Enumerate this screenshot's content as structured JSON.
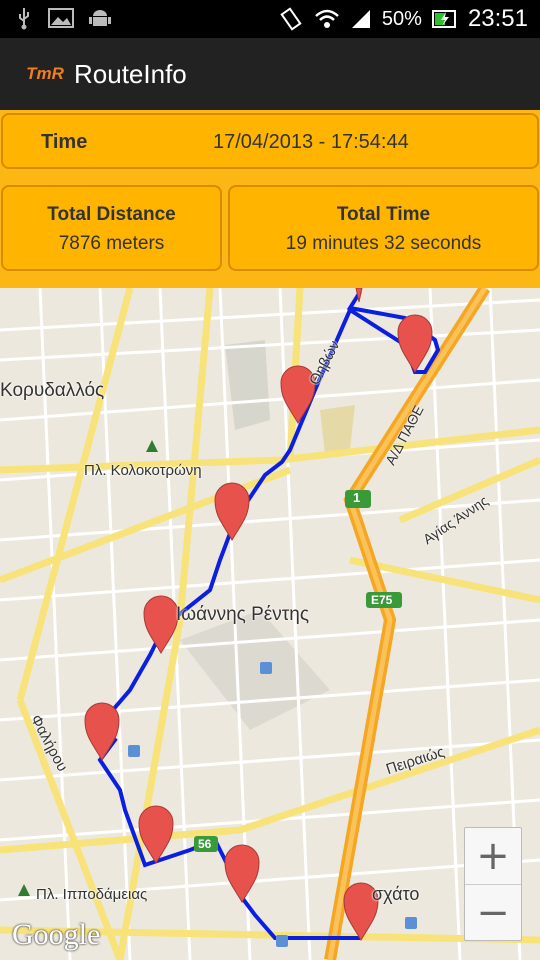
{
  "status_bar": {
    "battery": "50%",
    "time": "23:51"
  },
  "app": {
    "logo_text": "TmR",
    "title": "RouteInfo"
  },
  "info": {
    "time_label": "Time",
    "time_value": "17/04/2013 - 17:54:44",
    "distance_label": "Total Distance",
    "distance_value": "7876 meters",
    "total_time_label": "Total Time",
    "total_time_value": "19 minutes 32 seconds"
  },
  "map": {
    "labels": {
      "korydallos": "Κορυδαλλός",
      "kolokotroni": "Πλ. Κολοκοτρώνη",
      "rentis": "Ιωάννης Ρέντης",
      "faliro": "Φαλήρου",
      "ippodameias": "Πλ. Ιπποδάμειας",
      "thivon": "Θηβών",
      "athens_highway": "Α/Δ ΠΑΘΕ",
      "agias_annis": "Αγίας Άννης",
      "piraios": "Πειραιώς",
      "eschato": "σχάτο",
      "route_1": "1",
      "route_e75": "E75",
      "route_56": "56"
    },
    "attribution": "Google",
    "zoom_in": "+",
    "zoom_out": "−",
    "route_color": "#0a1fe0",
    "marker_color": "#e8524d"
  }
}
